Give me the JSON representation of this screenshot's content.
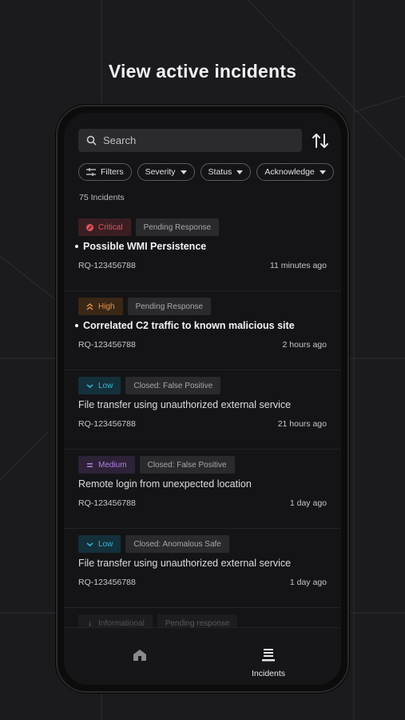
{
  "headline": "View active incidents",
  "search": {
    "placeholder": "Search"
  },
  "filters": [
    {
      "label": "Filters"
    },
    {
      "label": "Severity"
    },
    {
      "label": "Status"
    },
    {
      "label": "Acknowledge"
    }
  ],
  "incident_count": "75 Incidents",
  "incidents": [
    {
      "severity": "Critical",
      "severity_color": "#e0525a",
      "severity_bg": "#3a1e22",
      "status": "Pending Response",
      "title": "Possible WMI Persistence",
      "unread": true,
      "ref": "RQ-123456788",
      "time": "11 minutes ago"
    },
    {
      "severity": "High",
      "severity_color": "#e9944a",
      "severity_bg": "#3a2716",
      "status": "Pending Response",
      "title": "Correlated C2 traffic to known malicious site",
      "unread": true,
      "ref": "RQ-123456788",
      "time": "2 hours ago"
    },
    {
      "severity": "Low",
      "severity_color": "#33b9d4",
      "severity_bg": "#14303a",
      "status": "Closed: False Positive",
      "title": "File transfer using unauthorized external service",
      "unread": false,
      "ref": "RQ-123456788",
      "time": "21 hours ago"
    },
    {
      "severity": "Medium",
      "severity_color": "#b27ee0",
      "severity_bg": "#2d2238",
      "status": "Closed: False Positive",
      "title": "Remote login from unexpected location",
      "unread": false,
      "ref": "RQ-123456788",
      "time": "1 day ago"
    },
    {
      "severity": "Low",
      "severity_color": "#33b9d4",
      "severity_bg": "#14303a",
      "status": "Closed: Anomalous Safe",
      "title": "File transfer using unauthorized external service",
      "unread": false,
      "ref": "RQ-123456788",
      "time": "1 day ago"
    },
    {
      "severity": "Informational",
      "severity_color": "#9a9aa0",
      "severity_bg": "#2a2a2d",
      "status": "Pending response"
    }
  ],
  "nav": {
    "incidents_label": "Incidents"
  },
  "icons": {
    "search": "search-icon",
    "sort": "sort-arrows-icon",
    "filters": "sliders-icon",
    "home": "home-icon",
    "incidents": "list-icon"
  }
}
